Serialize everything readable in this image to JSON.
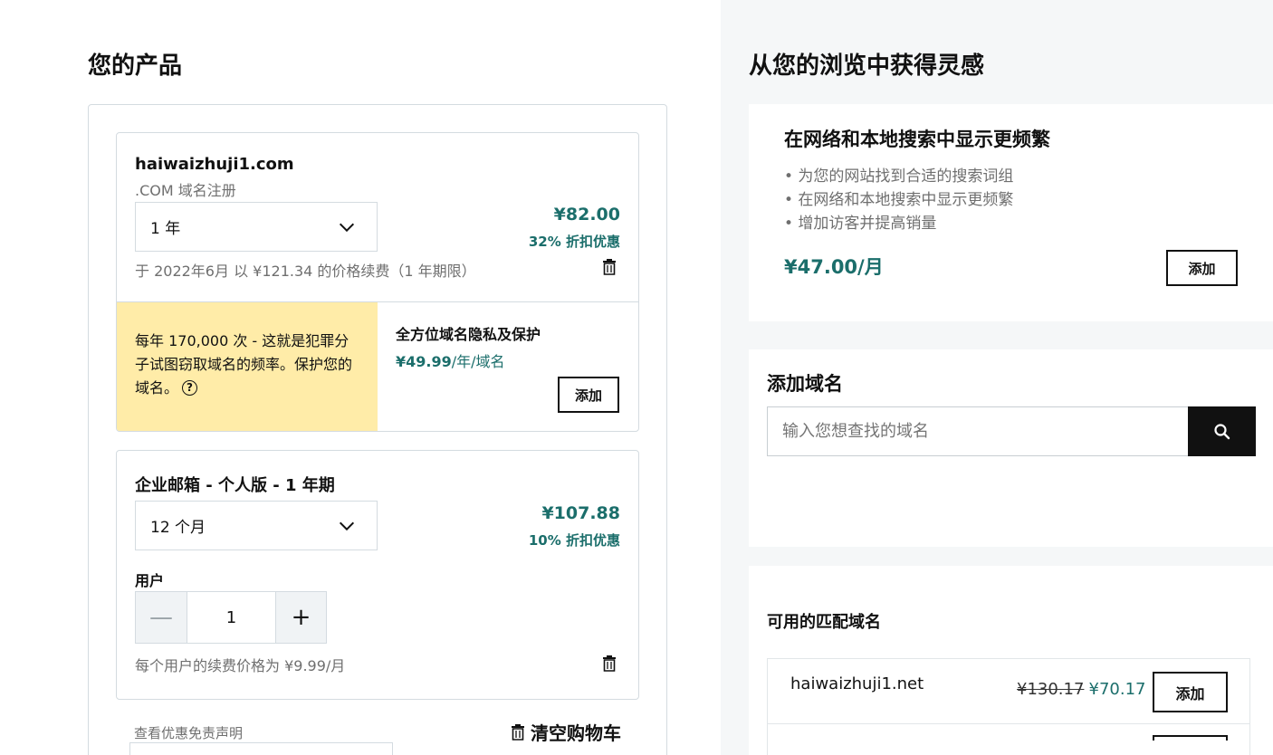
{
  "left": {
    "heading": "您的产品",
    "domain_item": {
      "name": "haiwaizhuji1.com",
      "subtitle": ".COM 域名注册",
      "term_selected": "1 年",
      "price": "¥82.00",
      "discount": "32% 折扣优惠",
      "renewal_note": "于 2022年6月 以 ¥121.34 的价格续费（1 年期限）",
      "promo_text": "每年 170,000 次 - 这就是犯罪分子试图窃取域名的频率。保护您的域名。",
      "help_icon": "?",
      "privacy_title": "全方位域名隐私及保护",
      "privacy_price_value": "¥49.99",
      "privacy_price_unit": "/年/域名",
      "add_label": "添加"
    },
    "email_item": {
      "title": "企业邮箱 - 个人版 - 1 年期",
      "term_selected": "12 个月",
      "price": "¥107.88",
      "discount": "10% 折扣优惠",
      "users_label": "用户",
      "user_count": "1",
      "renewal_note": "每个用户的续费价格为 ¥9.99/月"
    },
    "footer": {
      "disclaimer_link": "查看优惠免责声明",
      "clear_cart": "清空购物车"
    }
  },
  "right": {
    "heading": "从您的浏览中获得灵感",
    "seo_card": {
      "title": "在网络和本地搜索中显示更频繁",
      "bullets": [
        "• 为您的网站找到合适的搜索词组",
        "• 在网络和本地搜索中显示更频繁",
        "• 增加访客并提高销量"
      ],
      "price": "¥47.00/月",
      "add_label": "添加"
    },
    "add_domain": {
      "title": "添加域名",
      "placeholder": "输入您想查找的域名"
    },
    "matches": {
      "title": "可用的匹配域名",
      "items": [
        {
          "domain": "haiwaizhuji1.net",
          "old_price": "¥130.17",
          "new_price": "¥70.17",
          "add_label": "添加"
        }
      ]
    }
  },
  "icons": {
    "chevron": "chevron-down-icon",
    "trash": "trash-icon",
    "search": "search-icon",
    "minus": "minus-icon",
    "plus": "plus-icon",
    "help": "help-circle-icon"
  },
  "colors": {
    "accent_teal": "#1b6e6b",
    "promo_yellow": "#ffeca8",
    "border": "#d4dbe0",
    "right_bg": "#f5f7f8"
  }
}
